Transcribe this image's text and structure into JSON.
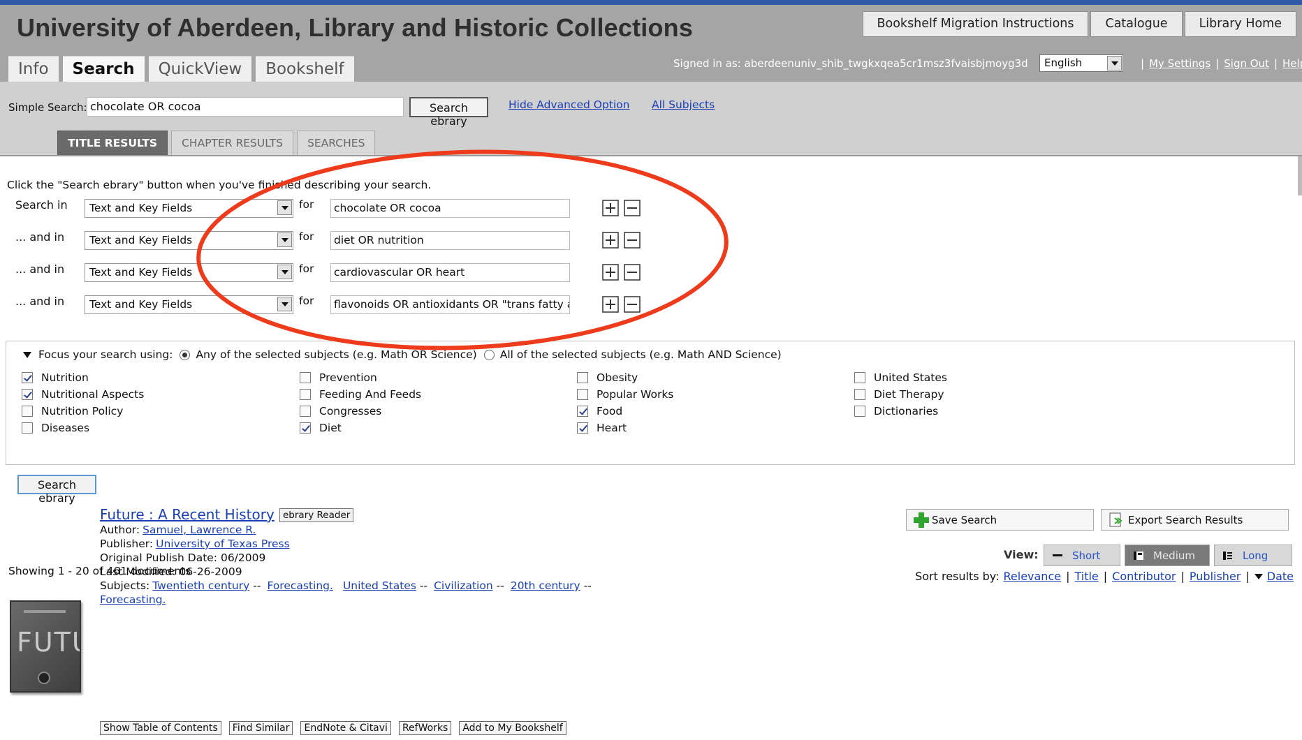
{
  "header": {
    "title": "University of Aberdeen, Library and Historic Collections",
    "top_links": [
      "Bookshelf Migration Instructions",
      "Catalogue",
      "Library Home"
    ],
    "tabs": [
      "Info",
      "Search",
      "QuickView",
      "Bookshelf"
    ],
    "active_tab": "Search",
    "signed_in": "Signed in as: aberdeenuniv_shib_twgkxqea5cr1msz3fvaisbjmoyg3d",
    "language": "English",
    "user_links": [
      "My Settings",
      "Sign Out",
      "Help"
    ],
    "color": "#a5a5a5"
  },
  "simple_search": {
    "label": "Simple Search:",
    "value": "chocolate OR cocoa",
    "button": "Search ebrary",
    "hide_advanced": "Hide Advanced Option",
    "all_subjects": "All Subjects"
  },
  "result_tabs": [
    "TITLE RESULTS",
    "CHAPTER RESULTS",
    "SEARCHES"
  ],
  "advanced": {
    "instruction": "Click the \"Search ebrary\" button when you've finished describing your search.",
    "for_label": "for",
    "rows": [
      {
        "label": "Search in",
        "field": "Text and Key Fields",
        "term": "chocolate OR cocoa"
      },
      {
        "label": "... and in",
        "field": "Text and Key Fields",
        "term": "diet OR nutrition"
      },
      {
        "label": "... and in",
        "field": "Text and Key Fields",
        "term": "cardiovascular OR heart"
      },
      {
        "label": "... and in",
        "field": "Text and Key Fields",
        "term": "flavonoids OR antioxidants OR \"trans fatty ac"
      }
    ]
  },
  "focus": {
    "label": "Focus your search using:",
    "option_any": "Any of the selected subjects (e.g. Math OR Science)",
    "option_all": "All of the selected subjects (e.g. Math AND Science)",
    "selected": "any",
    "subjects": [
      {
        "name": "Nutrition",
        "checked": true
      },
      {
        "name": "Nutritional Aspects",
        "checked": true
      },
      {
        "name": "Nutrition Policy",
        "checked": false
      },
      {
        "name": "Diseases",
        "checked": false
      },
      {
        "name": "Prevention",
        "checked": false
      },
      {
        "name": "Feeding And Feeds",
        "checked": false
      },
      {
        "name": "Congresses",
        "checked": false
      },
      {
        "name": "Diet",
        "checked": true
      },
      {
        "name": "Obesity",
        "checked": false
      },
      {
        "name": "Popular Works",
        "checked": false
      },
      {
        "name": "Food",
        "checked": true
      },
      {
        "name": "Heart",
        "checked": true
      },
      {
        "name": "United States",
        "checked": false
      },
      {
        "name": "Diet Therapy",
        "checked": false
      },
      {
        "name": "Dictionaries",
        "checked": false
      }
    ]
  },
  "search_button": "Search ebrary",
  "actions": {
    "save": "Save Search",
    "export": "Export Search Results"
  },
  "view": {
    "label": "View:",
    "options": [
      "Short",
      "Medium",
      "Long"
    ],
    "active": "Medium"
  },
  "sort": {
    "label": "Sort results by:",
    "options": [
      "Relevance",
      "Title",
      "Contributor",
      "Publisher",
      "Date"
    ]
  },
  "showing": "Showing 1 - 20 of 461 documents",
  "result": {
    "title": "Future : A Recent History",
    "badge": "ebrary Reader",
    "cover_text": "FUTU",
    "author_label": "Author:",
    "author": "Samuel, Lawrence R.",
    "publisher_label": "Publisher:",
    "publisher": "University of Texas Press",
    "publish_date": "Original Publish Date: 06/2009",
    "modified": "Last Modified: 06-26-2009",
    "subjects_label": "Subjects:",
    "subjects": [
      "Twentieth century",
      "Forecasting.",
      "United States",
      "Civilization",
      "20th century",
      "Forecasting."
    ],
    "buttons": [
      "Show Table of Contents",
      "Find Similar",
      "EndNote & Citavi",
      "RefWorks",
      "Add to My Bookshelf"
    ]
  },
  "annotation": {
    "shape": "ellipse",
    "color": "#ee3b1c"
  }
}
